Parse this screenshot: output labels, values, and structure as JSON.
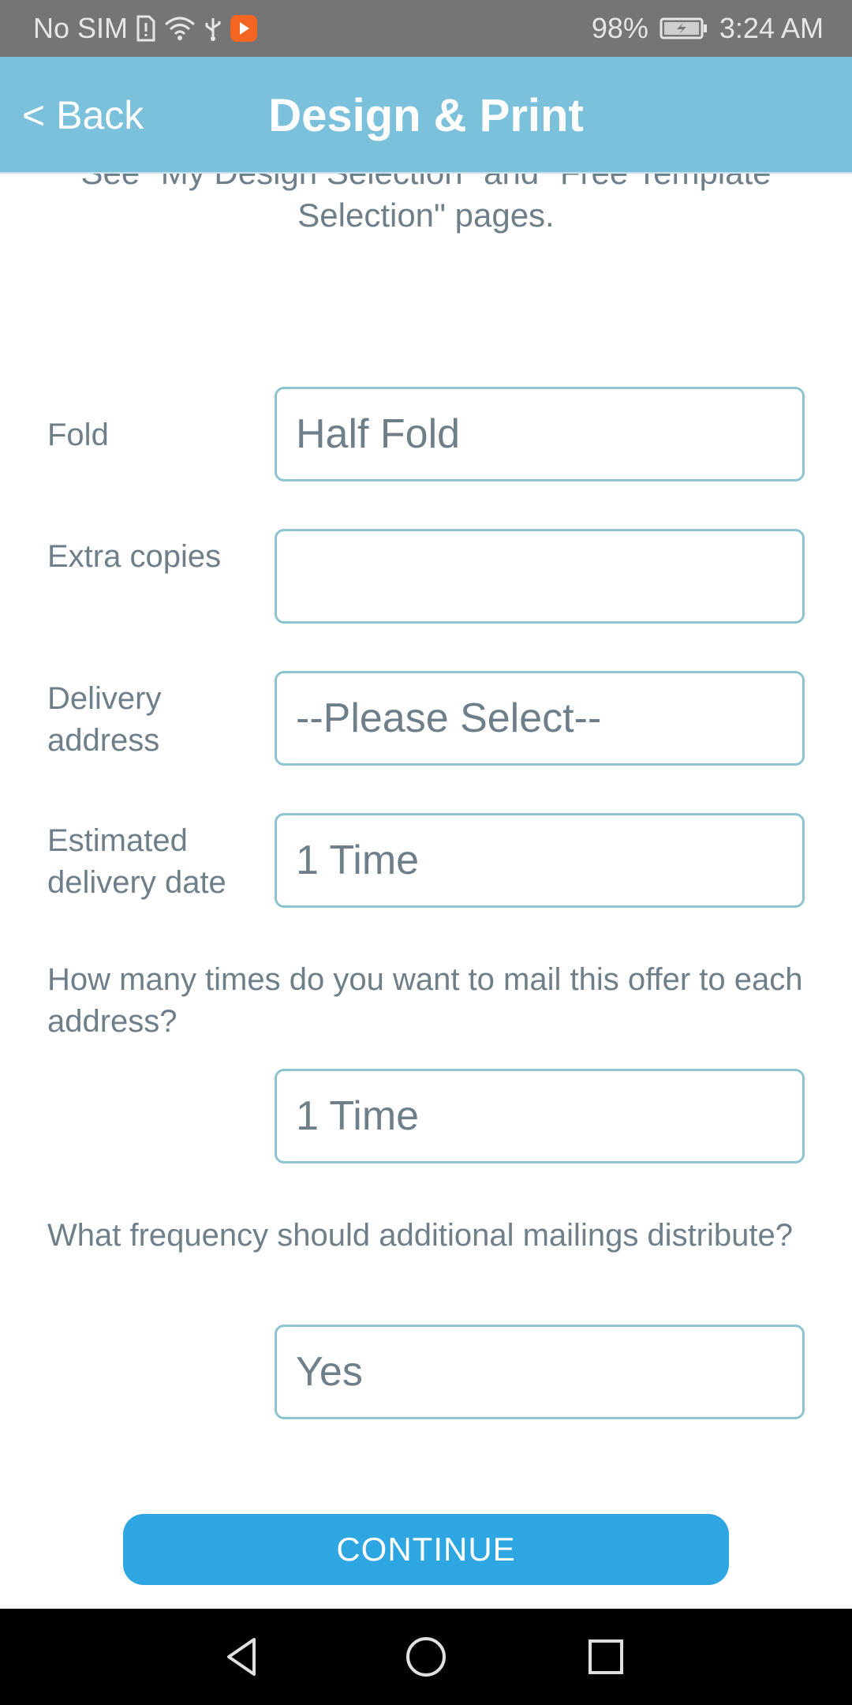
{
  "status_bar": {
    "carrier": "No SIM",
    "battery": "98%",
    "time": "3:24 AM",
    "icons": [
      "sim-alert-icon",
      "wifi-icon",
      "usb-icon",
      "app-notification-icon",
      "battery-charging-icon"
    ]
  },
  "header": {
    "back_label": "< Back",
    "title": "Design & Print"
  },
  "intro": {
    "text": "See \"My Design Selection\" and \"Free Template Selection\" pages."
  },
  "form": {
    "fold": {
      "label": "Fold",
      "value": "Half Fold"
    },
    "extra_copies": {
      "label": "Extra copies",
      "value": ""
    },
    "delivery_address": {
      "label": "Delivery address",
      "value": "--Please Select--"
    },
    "estimated_delivery_date": {
      "label": "Estimated delivery date",
      "value": "1 Time"
    },
    "mail_times": {
      "question": "How many times do you want to mail this offer to each address?",
      "value": "1 Time"
    },
    "frequency": {
      "question": "What frequency should additional mailings distribute?",
      "value": "Yes"
    }
  },
  "continue_label": "CONTINUE",
  "colors": {
    "header": "#7cc1db",
    "status_bar": "#757575",
    "button": "#2ea6e2",
    "field_border": "#8fc3cf",
    "text": "#6f7f8a"
  },
  "nav": {
    "icons": [
      "back-nav-icon",
      "home-nav-icon",
      "recents-nav-icon"
    ]
  }
}
